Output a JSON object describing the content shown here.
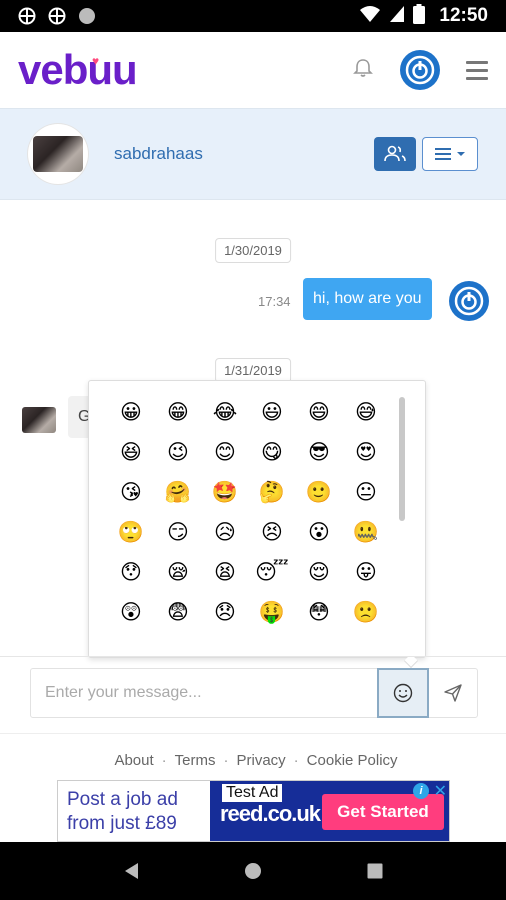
{
  "status_bar": {
    "time": "12:50"
  },
  "header": {
    "logo": "vebuu"
  },
  "contact": {
    "name": "sabdrahaas"
  },
  "chat": {
    "messages": [
      {
        "date": "1/30/2019",
        "time": "17:34",
        "text": "hi, how are you",
        "direction": "out"
      },
      {
        "date": "1/31/2019",
        "text": "G",
        "direction": "in"
      }
    ]
  },
  "emoji_picker": {
    "emojis": [
      "😀",
      "😁",
      "😂",
      "😃",
      "😄",
      "😅",
      "😆",
      "😉",
      "😊",
      "😋",
      "😎",
      "😍",
      "😘",
      "🤗",
      "🤩",
      "🤔",
      "🙂",
      "😐",
      "🙄",
      "😏",
      "😥",
      "😣",
      "😮",
      "🤐",
      "😯",
      "😪",
      "😫",
      "😴",
      "😌",
      "😛",
      "😲",
      "😨",
      "😞",
      "🤑",
      "😳",
      "🙁"
    ]
  },
  "composer": {
    "placeholder": "Enter your message..."
  },
  "footer": {
    "links": [
      "About",
      "Terms",
      "Privacy",
      "Cookie Policy"
    ],
    "separator": "·"
  },
  "ad": {
    "text_line1": "Post a job ad",
    "text_line2": "from just £89",
    "tag": "Test Ad",
    "brand": "reed.co.uk",
    "cta": "Get Started"
  },
  "colors": {
    "brand": "#6a1fc9",
    "accent": "#1d72c9",
    "bubble_out": "#3fa6f2",
    "contact_bar": "#e7f0fa"
  },
  "icons": [
    "wifi-icon",
    "globe-icon",
    "dot-icon",
    "signal-icon",
    "battery-icon",
    "bell-icon",
    "power-icon",
    "menu-icon",
    "people-icon",
    "list-icon",
    "smile-icon",
    "send-icon",
    "back-icon",
    "home-icon",
    "recents-icon"
  ]
}
